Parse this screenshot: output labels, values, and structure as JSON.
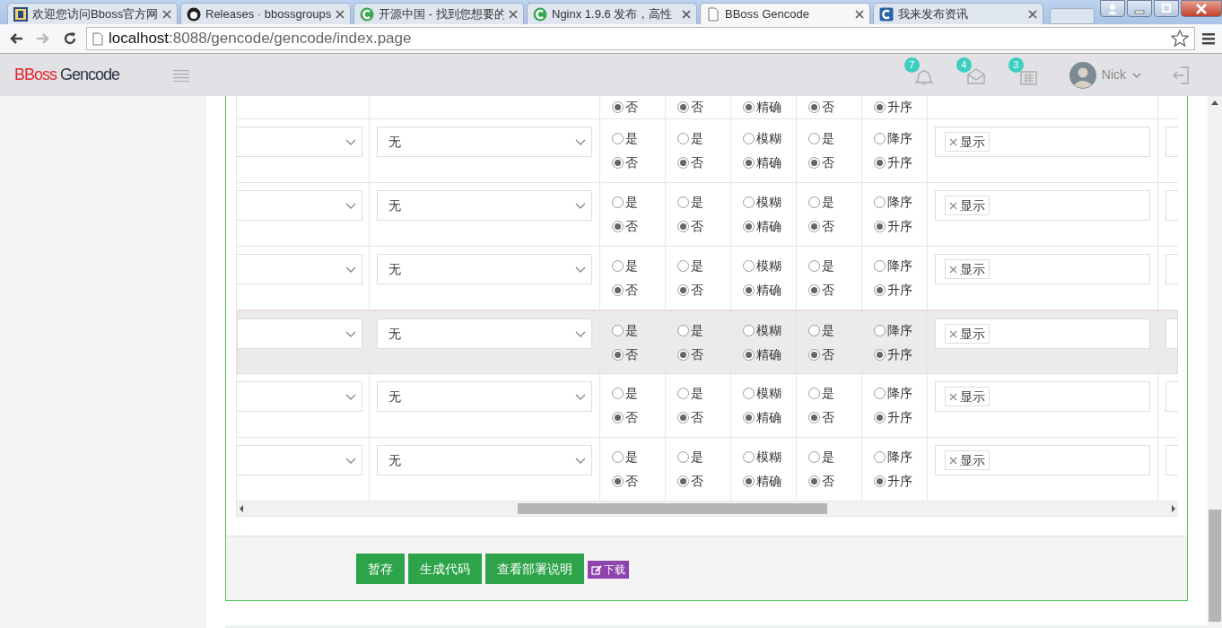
{
  "browser": {
    "tabs": [
      {
        "title": "欢迎您访问Bboss官方网",
        "selected": false
      },
      {
        "title": "Releases · bbossgroups",
        "selected": false
      },
      {
        "title": "开源中国 - 找到您想要的",
        "selected": false
      },
      {
        "title": "Nginx 1.9.6 发布，高性",
        "selected": false
      },
      {
        "title": "BBoss Gencode",
        "selected": true
      },
      {
        "title": "我来发布资讯",
        "selected": false
      }
    ],
    "nav": [
      {
        "kind": "back",
        "disabled": false
      },
      {
        "kind": "forward",
        "disabled": true
      },
      {
        "kind": "reload",
        "disabled": false
      }
    ],
    "address": {
      "host": "localhost",
      "path": ":8088/gencode/gencode/index.page"
    }
  },
  "app": {
    "brand": {
      "first": "BBoss",
      "second": "Gencode"
    },
    "notifications": [
      {
        "kind": "bell",
        "count": "7"
      },
      {
        "kind": "envelope",
        "count": "4"
      },
      {
        "kind": "calendar",
        "count": "3"
      }
    ],
    "user": {
      "name": "Nick"
    }
  },
  "table": {
    "partial_row": {
      "radios": [
        {
          "label": "否",
          "selected": true
        },
        {
          "label": "否",
          "selected": true
        },
        {
          "label": "精确",
          "selected": true
        },
        {
          "label": "否",
          "selected": true
        },
        {
          "label": "升序",
          "selected": true
        }
      ]
    },
    "rows": [
      {
        "highlighted": false,
        "select_value": "无",
        "radios": [
          [
            {
              "label": "是",
              "selected": false
            },
            {
              "label": "否",
              "selected": true
            }
          ],
          [
            {
              "label": "是",
              "selected": false
            },
            {
              "label": "否",
              "selected": true
            }
          ],
          [
            {
              "label": "模糊",
              "selected": false
            },
            {
              "label": "精确",
              "selected": true
            }
          ],
          [
            {
              "label": "是",
              "selected": false
            },
            {
              "label": "否",
              "selected": true
            }
          ],
          [
            {
              "label": "降序",
              "selected": false
            },
            {
              "label": "升序",
              "selected": true
            }
          ]
        ],
        "tags": [
          "显示"
        ]
      },
      {
        "highlighted": false,
        "select_value": "无",
        "radios": [
          [
            {
              "label": "是",
              "selected": false
            },
            {
              "label": "否",
              "selected": true
            }
          ],
          [
            {
              "label": "是",
              "selected": false
            },
            {
              "label": "否",
              "selected": true
            }
          ],
          [
            {
              "label": "模糊",
              "selected": false
            },
            {
              "label": "精确",
              "selected": true
            }
          ],
          [
            {
              "label": "是",
              "selected": false
            },
            {
              "label": "否",
              "selected": true
            }
          ],
          [
            {
              "label": "降序",
              "selected": false
            },
            {
              "label": "升序",
              "selected": true
            }
          ]
        ],
        "tags": [
          "显示"
        ]
      },
      {
        "highlighted": false,
        "select_value": "无",
        "radios": [
          [
            {
              "label": "是",
              "selected": false
            },
            {
              "label": "否",
              "selected": true
            }
          ],
          [
            {
              "label": "是",
              "selected": false
            },
            {
              "label": "否",
              "selected": true
            }
          ],
          [
            {
              "label": "模糊",
              "selected": false
            },
            {
              "label": "精确",
              "selected": true
            }
          ],
          [
            {
              "label": "是",
              "selected": false
            },
            {
              "label": "否",
              "selected": true
            }
          ],
          [
            {
              "label": "降序",
              "selected": false
            },
            {
              "label": "升序",
              "selected": true
            }
          ]
        ],
        "tags": [
          "显示"
        ]
      },
      {
        "highlighted": true,
        "select_value": "无",
        "radios": [
          [
            {
              "label": "是",
              "selected": false
            },
            {
              "label": "否",
              "selected": true
            }
          ],
          [
            {
              "label": "是",
              "selected": false
            },
            {
              "label": "否",
              "selected": true
            }
          ],
          [
            {
              "label": "模糊",
              "selected": false
            },
            {
              "label": "精确",
              "selected": true
            }
          ],
          [
            {
              "label": "是",
              "selected": false
            },
            {
              "label": "否",
              "selected": true
            }
          ],
          [
            {
              "label": "降序",
              "selected": false
            },
            {
              "label": "升序",
              "selected": true
            }
          ]
        ],
        "tags": [
          "显示"
        ]
      },
      {
        "highlighted": false,
        "select_value": "无",
        "radios": [
          [
            {
              "label": "是",
              "selected": false
            },
            {
              "label": "否",
              "selected": true
            }
          ],
          [
            {
              "label": "是",
              "selected": false
            },
            {
              "label": "否",
              "selected": true
            }
          ],
          [
            {
              "label": "模糊",
              "selected": false
            },
            {
              "label": "精确",
              "selected": true
            }
          ],
          [
            {
              "label": "是",
              "selected": false
            },
            {
              "label": "否",
              "selected": true
            }
          ],
          [
            {
              "label": "降序",
              "selected": false
            },
            {
              "label": "升序",
              "selected": true
            }
          ]
        ],
        "tags": [
          "显示"
        ]
      },
      {
        "highlighted": false,
        "select_value": "无",
        "radios": [
          [
            {
              "label": "是",
              "selected": false
            },
            {
              "label": "否",
              "selected": true
            }
          ],
          [
            {
              "label": "是",
              "selected": false
            },
            {
              "label": "否",
              "selected": true
            }
          ],
          [
            {
              "label": "模糊",
              "selected": false
            },
            {
              "label": "精确",
              "selected": true
            }
          ],
          [
            {
              "label": "是",
              "selected": false
            },
            {
              "label": "否",
              "selected": true
            }
          ],
          [
            {
              "label": "降序",
              "selected": false
            },
            {
              "label": "升序",
              "selected": true
            }
          ]
        ],
        "tags": [
          "显示"
        ]
      }
    ]
  },
  "actions": [
    {
      "label": "暂存",
      "kind": "button"
    },
    {
      "label": "生成代码",
      "kind": "button"
    },
    {
      "label": "查看部署说明",
      "kind": "button"
    },
    {
      "label": "下载",
      "kind": "label"
    }
  ]
}
